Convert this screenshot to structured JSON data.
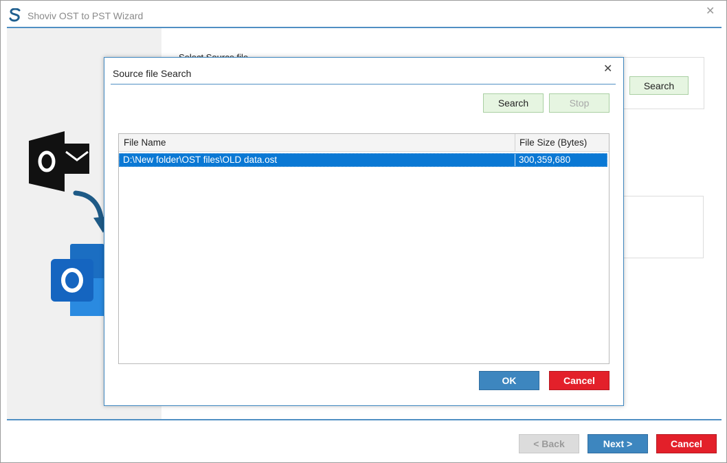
{
  "window": {
    "title": "Shoviv OST to PST Wizard",
    "close_glyph": "✕",
    "logo_icon": "shoviv-logo-icon"
  },
  "background": {
    "section_label": "Select Source file",
    "search_label": "Search",
    "icons": [
      "ost-outlook-icon",
      "arrow-down-icon",
      "outlook-pst-icon"
    ],
    "accent_color": "#4f8fc3"
  },
  "dialog": {
    "title": "Source file Search",
    "close_glyph": "✕",
    "search_label": "Search",
    "stop_label": "Stop",
    "ok_label": "OK",
    "cancel_label": "Cancel",
    "table": {
      "columns": [
        "File Name",
        "File Size (Bytes)"
      ],
      "rows": [
        {
          "file_name": "D:\\New folder\\OST files\\OLD data.ost",
          "file_size": "300,359,680",
          "selected": true
        }
      ]
    }
  },
  "footer": {
    "back_label": "< Back",
    "back_disabled": true,
    "next_label": "Next >",
    "cancel_label": "Cancel"
  },
  "colors": {
    "primary_button": "#3d86bf",
    "danger_button": "#e3202a",
    "selection": "#0a78d4",
    "secondary_button_bg": "#e6f5e1"
  }
}
